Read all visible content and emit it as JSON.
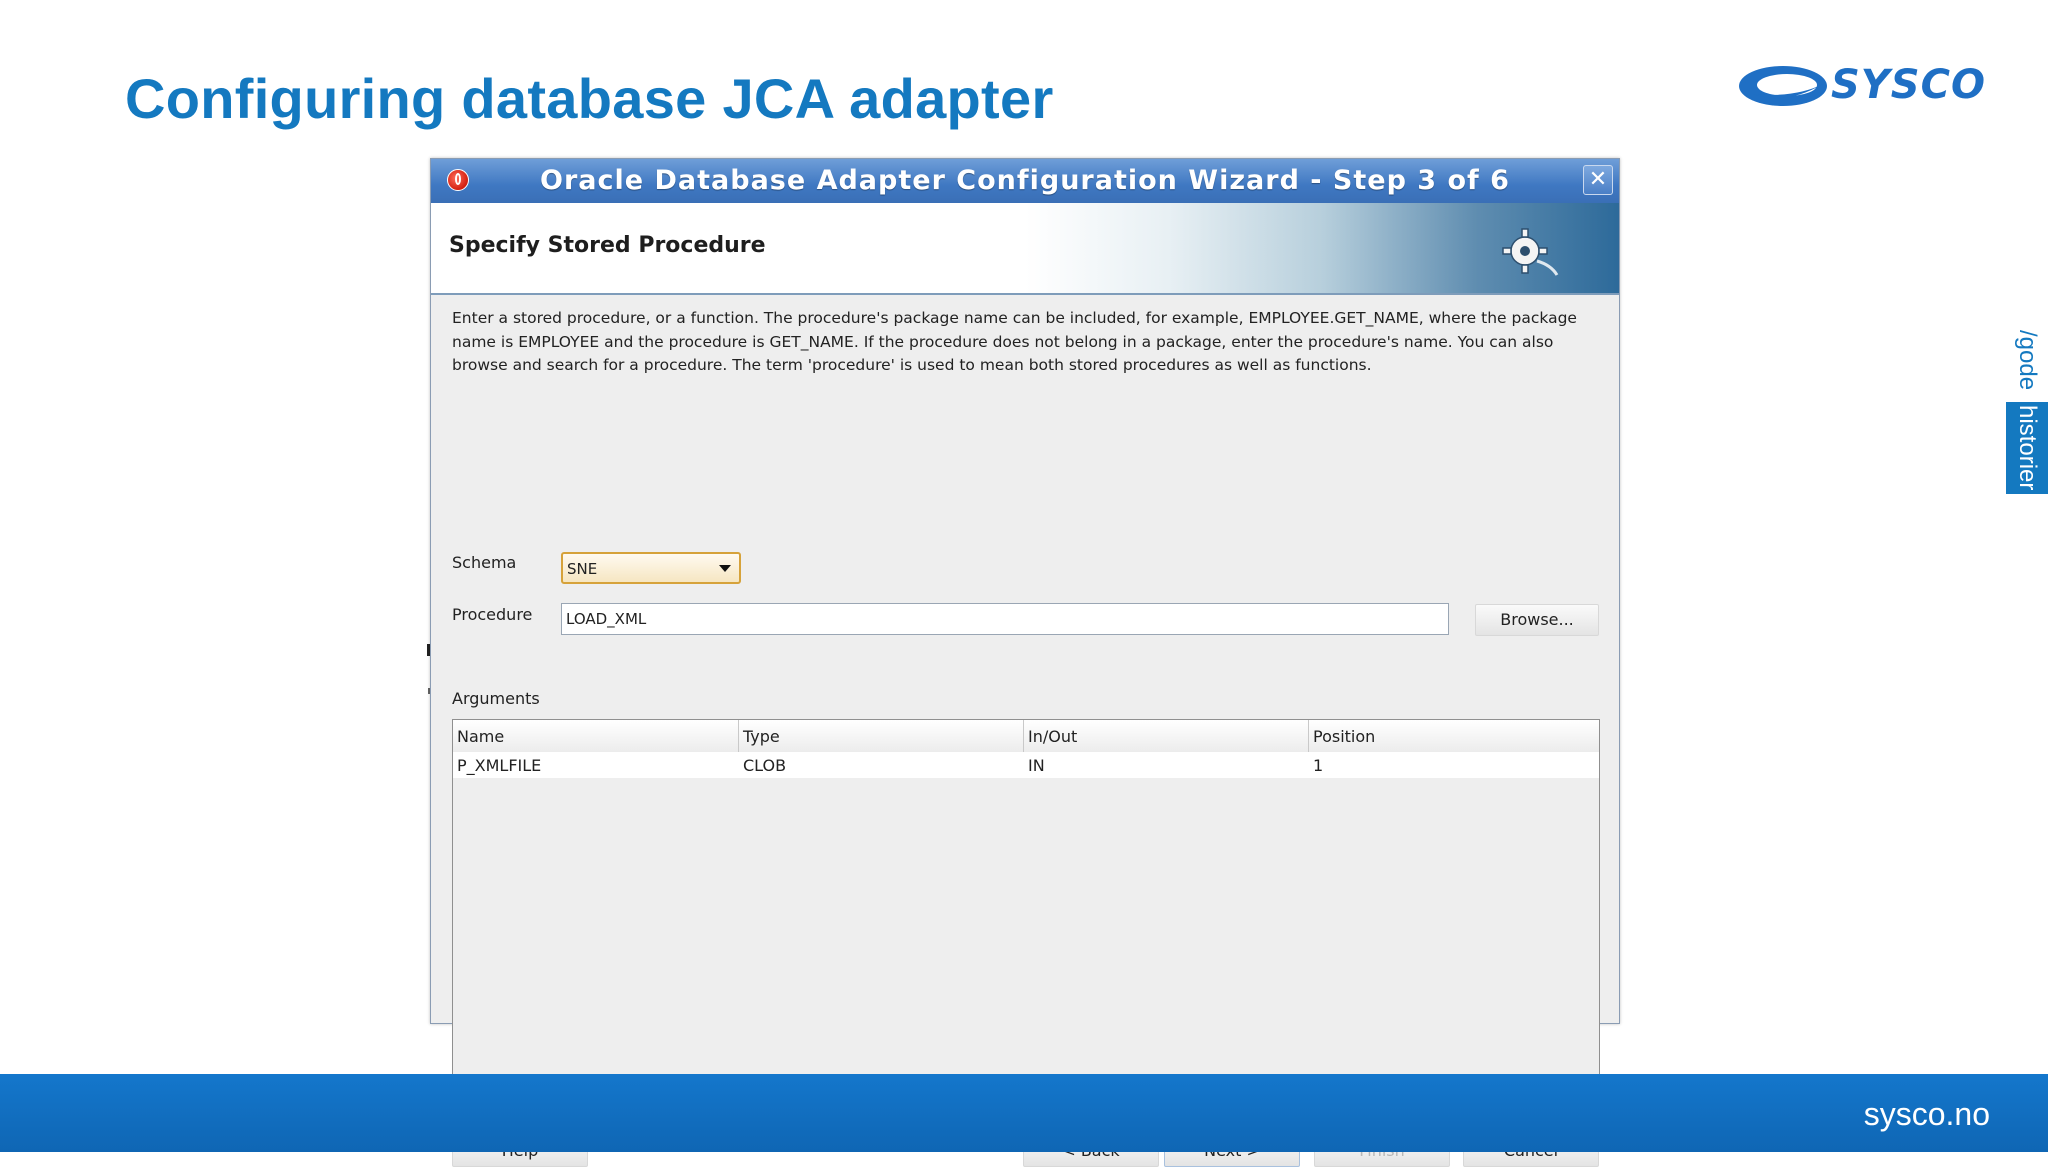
{
  "slide": {
    "title": "Configuring database JCA adapter",
    "logo_text": "SYSCO",
    "side_tab_text_1": "/gode",
    "side_tab_text_2": "historier",
    "footer_text": "sysco.no"
  },
  "dialog": {
    "title": "Oracle Database Adapter Configuration Wizard - Step 3 of 6",
    "banner_title": "Specify Stored Procedure",
    "description": "Enter a stored procedure, or a function. The procedure's package name can be included, for example, EMPLOYEE.GET_NAME, where the package name is EMPLOYEE and the procedure is GET_NAME.  If the procedure does not belong in a package, enter the procedure's name. You can also browse and search for a procedure. The term 'procedure' is used to mean both stored procedures as well as functions.",
    "schema_label": "Schema",
    "schema_value": "SNE",
    "procedure_label": "Procedure",
    "procedure_value": "LOAD_XML",
    "browse_label": "Browse...",
    "arguments_label": "Arguments",
    "table": {
      "columns": [
        "Name",
        "Type",
        "In/Out",
        "Position"
      ],
      "rows": [
        [
          "P_XMLFILE",
          "CLOB",
          "IN",
          "1"
        ]
      ]
    },
    "buttons": {
      "help": "Help",
      "back": "< Back",
      "next": "Next >",
      "finish": "Finish",
      "cancel": "Cancel"
    }
  },
  "colors": {
    "title_blue": "#1479c0",
    "footer_blue": "#1477cc",
    "dialog_titlebar": "#3f78c2"
  },
  "icons": [
    "oracle-icon",
    "close-icon",
    "gear-icon",
    "dropdown-arrow-icon",
    "sysco-logo"
  ]
}
